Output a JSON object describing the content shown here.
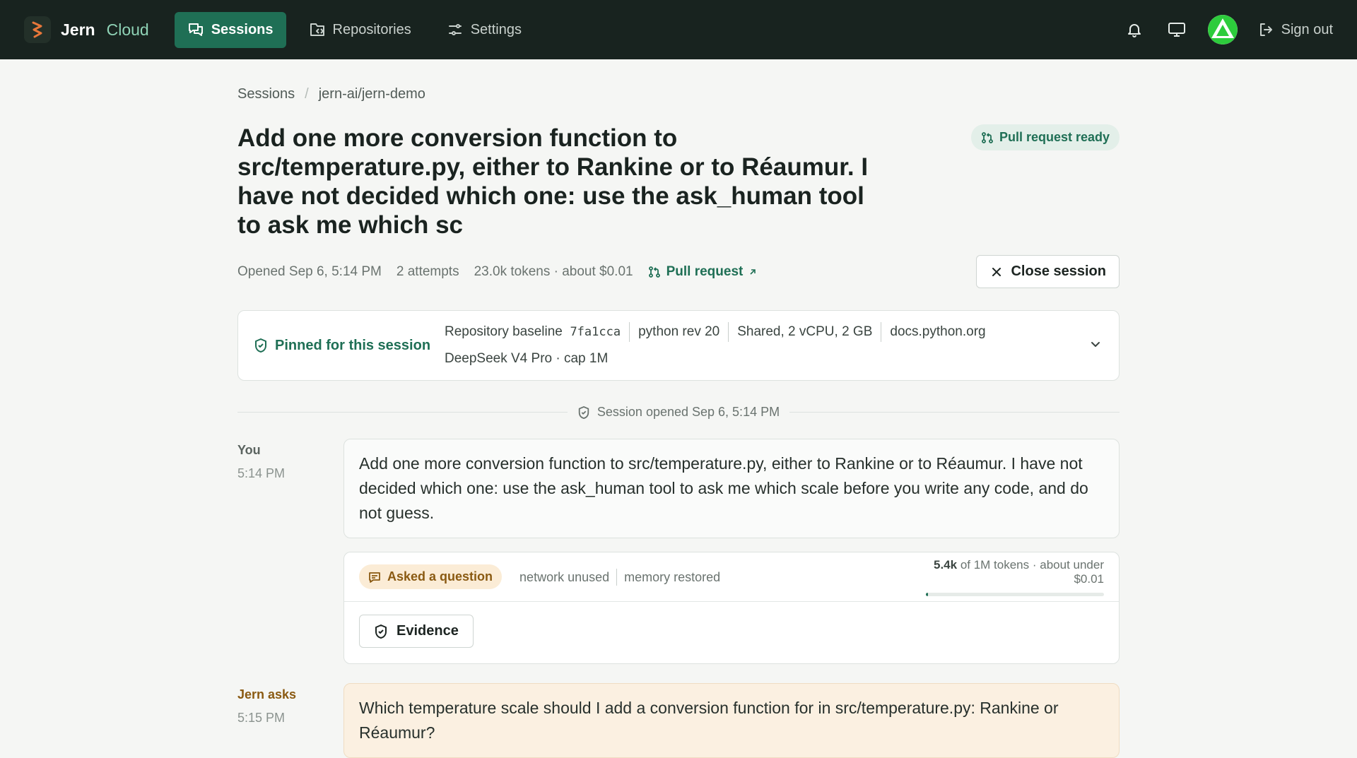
{
  "header": {
    "brand_name": "Jern",
    "brand_product": "Cloud",
    "nav": [
      {
        "label": "Sessions",
        "icon": "chat-icon",
        "active": true
      },
      {
        "label": "Repositories",
        "icon": "repository-icon",
        "active": false
      },
      {
        "label": "Settings",
        "icon": "sliders-icon",
        "active": false
      }
    ],
    "sign_out_label": "Sign out"
  },
  "breadcrumb": {
    "root": "Sessions",
    "separator": "/",
    "current": "jern-ai/jern-demo"
  },
  "session": {
    "title": "Add one more conversion function to src/temperature.py, either to Rankine or to Réaumur. I have not decided which one: use the ask_human tool to ask me which sc",
    "status": "Pull request ready",
    "opened": "Opened Sep 6, 5:14 PM",
    "attempts": "2 attempts",
    "tokens_cost": "23.0k tokens · about $0.01",
    "pr_link_label": "Pull request",
    "close_label": "Close session"
  },
  "pinned": {
    "label": "Pinned for this session",
    "baseline_label": "Repository baseline",
    "baseline_hash": "7fa1cca",
    "python": "python rev 20",
    "compute": "Shared, 2 vCPU, 2 GB",
    "docs": "docs.python.org",
    "model": "DeepSeek V4 Pro · cap 1M"
  },
  "timeline": {
    "opened_label": "Session opened Sep 6, 5:14 PM"
  },
  "messages": {
    "user": {
      "author": "You",
      "time": "5:14 PM",
      "text": "Add one more conversion function to src/temperature.py, either to Rankine or to Réaumur. I have not decided which one: use the ask_human tool to ask me which scale before you write any code, and do not guess."
    },
    "attempt": {
      "status": "Asked a question",
      "meta": [
        "network unused",
        "memory restored"
      ],
      "tokens_used": "5.4k",
      "tokens_rest": "of 1M tokens · about under $0.01",
      "usage_fraction": 0.0054,
      "evidence_label": "Evidence"
    },
    "ask": {
      "author": "Jern asks",
      "time": "5:15 PM",
      "text": "Which temperature scale should I add a conversion function for in src/temperature.py: Rankine or Réaumur?"
    }
  },
  "colors": {
    "accent": "#1f6f55",
    "topbar": "#18231f",
    "warning": "#8a5a12"
  }
}
